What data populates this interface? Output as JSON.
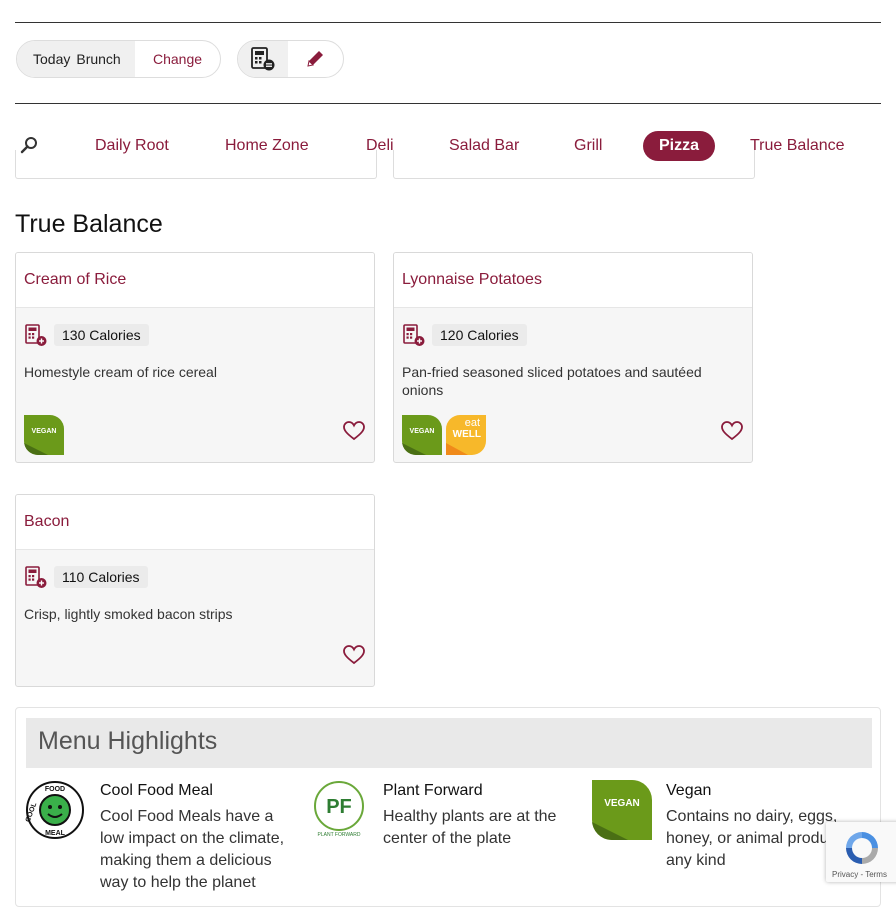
{
  "header": {
    "date_label": "Today",
    "meal_label": "Brunch",
    "change_label": "Change"
  },
  "tabs": [
    "Daily Root",
    "Home Zone",
    "Deli",
    "Salad Bar",
    "Grill",
    "Pizza",
    "True Balance"
  ],
  "active_tab": "Pizza",
  "section": {
    "title": "True Balance"
  },
  "items": [
    {
      "name": "Cream of Rice",
      "calories": "130 Calories",
      "description": "Homestyle cream of rice cereal",
      "badges": [
        "VEGAN"
      ]
    },
    {
      "name": "Lyonnaise Potatoes",
      "calories": "120 Calories",
      "description": "Pan-fried seasoned sliced potatoes and sautéed onions",
      "badges": [
        "VEGAN",
        "eat WELL"
      ]
    },
    {
      "name": "Bacon",
      "calories": "110 Calories",
      "description": "Crisp, lightly smoked bacon strips",
      "badges": []
    }
  ],
  "highlights": {
    "title": "Menu Highlights",
    "items": [
      {
        "title": "Cool Food Meal",
        "text": "Cool Food Meals have a low impact on the climate, making them a delicious way to help the planet",
        "icon_text": [
          "COOL",
          "FOOD",
          "MEAL"
        ]
      },
      {
        "title": "Plant Forward",
        "text": "Healthy plants are at the center of the plate",
        "icon_text": [
          "PF",
          "PLANT FORWARD"
        ]
      },
      {
        "title": "Vegan",
        "text": "Contains no dairy, eggs, honey, or animal products of any kind",
        "icon_text": [
          "VEGAN"
        ]
      }
    ]
  },
  "recaptcha": {
    "links": "Privacy - Terms"
  },
  "colors": {
    "accent": "#8a1c3c",
    "vegan": "#6b9a1a",
    "eatwell": "#f7b82a"
  }
}
